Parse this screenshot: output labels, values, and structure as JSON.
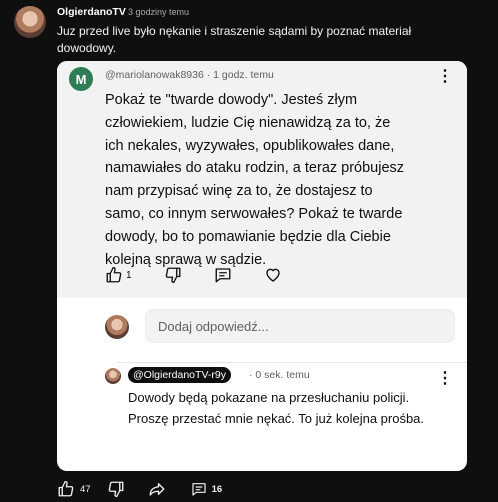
{
  "comment": {
    "author": "OlgierdanoTV",
    "time": "3 godziny temu",
    "text": "Juz przed live było nękanie i straszenie sądami by poznać materiał dowodowy."
  },
  "card": {
    "reply": {
      "avatar_letter": "M",
      "handle": "@mariolanowak8936",
      "time": "· 1 godz. temu",
      "text": "Pokaż te \"twarde dowody\". Jesteś złym człowiekiem, ludzie Cię nienawidzą za to, że ich nekales, wyzywałes, opublikowałes dane, namawiałes do ataku rodzin, a teraz próbujesz nam przypisać winę za to, że dostajesz to samo, co innym serwowałes? Pokaż te twarde dowody, bo to pomawianie będzie dla Ciebie kolejną sprawą w sądzie.",
      "like_count": "1"
    },
    "input_placeholder": "Dodaj odpowiedź...",
    "own_reply": {
      "handle": "@OlgierdanoTV-r9y",
      "time": "· 0 sek. temu",
      "text": "Dowody będą pokazane na przesłuchaniu policji. Proszę przestać mnie nękać. To już kolejna prośba."
    }
  },
  "bottom_bar": {
    "like_count": "47",
    "reply_count": "16"
  },
  "icons": {
    "like": "thumbs-up-icon",
    "dislike": "thumbs-down-icon",
    "comment": "comment-icon",
    "heart": "heart-icon",
    "share": "share-icon",
    "more": "more-vert-icon"
  },
  "colors": {
    "background": "#0f0f0f",
    "card": "#ffffff",
    "card_top": "#f2f2f2",
    "avatar_m": "#2e7d57"
  }
}
